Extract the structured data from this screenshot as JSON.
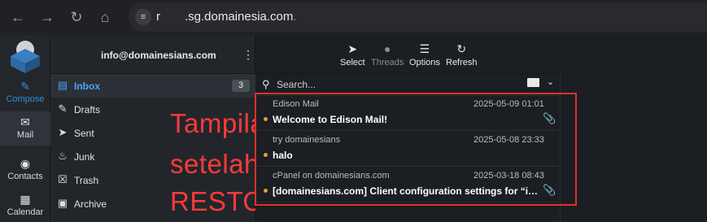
{
  "browser": {
    "url_prefix": "r",
    "url_domain": ".sg.domainesia.com",
    "url_suffix": ".",
    "back_icon": "arrow-left",
    "forward_icon": "arrow-right",
    "reload_icon": "reload",
    "home_icon": "home",
    "site_info_icon": "tune"
  },
  "leftbar": {
    "items": [
      {
        "label": "Compose",
        "icon": "pencil-square"
      },
      {
        "label": "Mail",
        "icon": "envelope"
      },
      {
        "label": "Contacts",
        "icon": "people"
      },
      {
        "label": "Calendar",
        "icon": "calendar"
      }
    ]
  },
  "folders": {
    "account": "info@domainesians.com",
    "items": [
      {
        "label": "Inbox",
        "icon": "inbox",
        "count": "3"
      },
      {
        "label": "Drafts",
        "icon": "pencil"
      },
      {
        "label": "Sent",
        "icon": "paper-plane"
      },
      {
        "label": "Junk",
        "icon": "fire"
      },
      {
        "label": "Trash",
        "icon": "trash"
      },
      {
        "label": "Archive",
        "icon": "archive"
      }
    ]
  },
  "toolbar": {
    "items": [
      {
        "label": "Select",
        "icon": "cursor"
      },
      {
        "label": "Threads",
        "icon": "chat-bubbles"
      },
      {
        "label": "Options",
        "icon": "sliders"
      },
      {
        "label": "Refresh",
        "icon": "refresh"
      }
    ]
  },
  "search": {
    "placeholder": "Search..."
  },
  "messages": [
    {
      "from": "Edison Mail",
      "date": "2025-05-09 01:01",
      "subject": "Welcome to Edison Mail!",
      "attachment": true
    },
    {
      "from": "try domainesians",
      "date": "2025-05-08 23:33",
      "subject": "halo",
      "attachment": false
    },
    {
      "from": "cPanel on domainesians.com",
      "date": "2025-03-18 08:43",
      "subject": "[domainesians.com] Client configuration settings for “info@do…",
      "attachment": true
    }
  ],
  "overlay": {
    "lines": [
      "Tampilan",
      "setelah",
      "RESTORE"
    ],
    "color": "#ff3a3a"
  },
  "colors": {
    "accent": "#4aa3ff",
    "unread_dot": "#e0a030",
    "highlight_box": "#e0312b"
  }
}
